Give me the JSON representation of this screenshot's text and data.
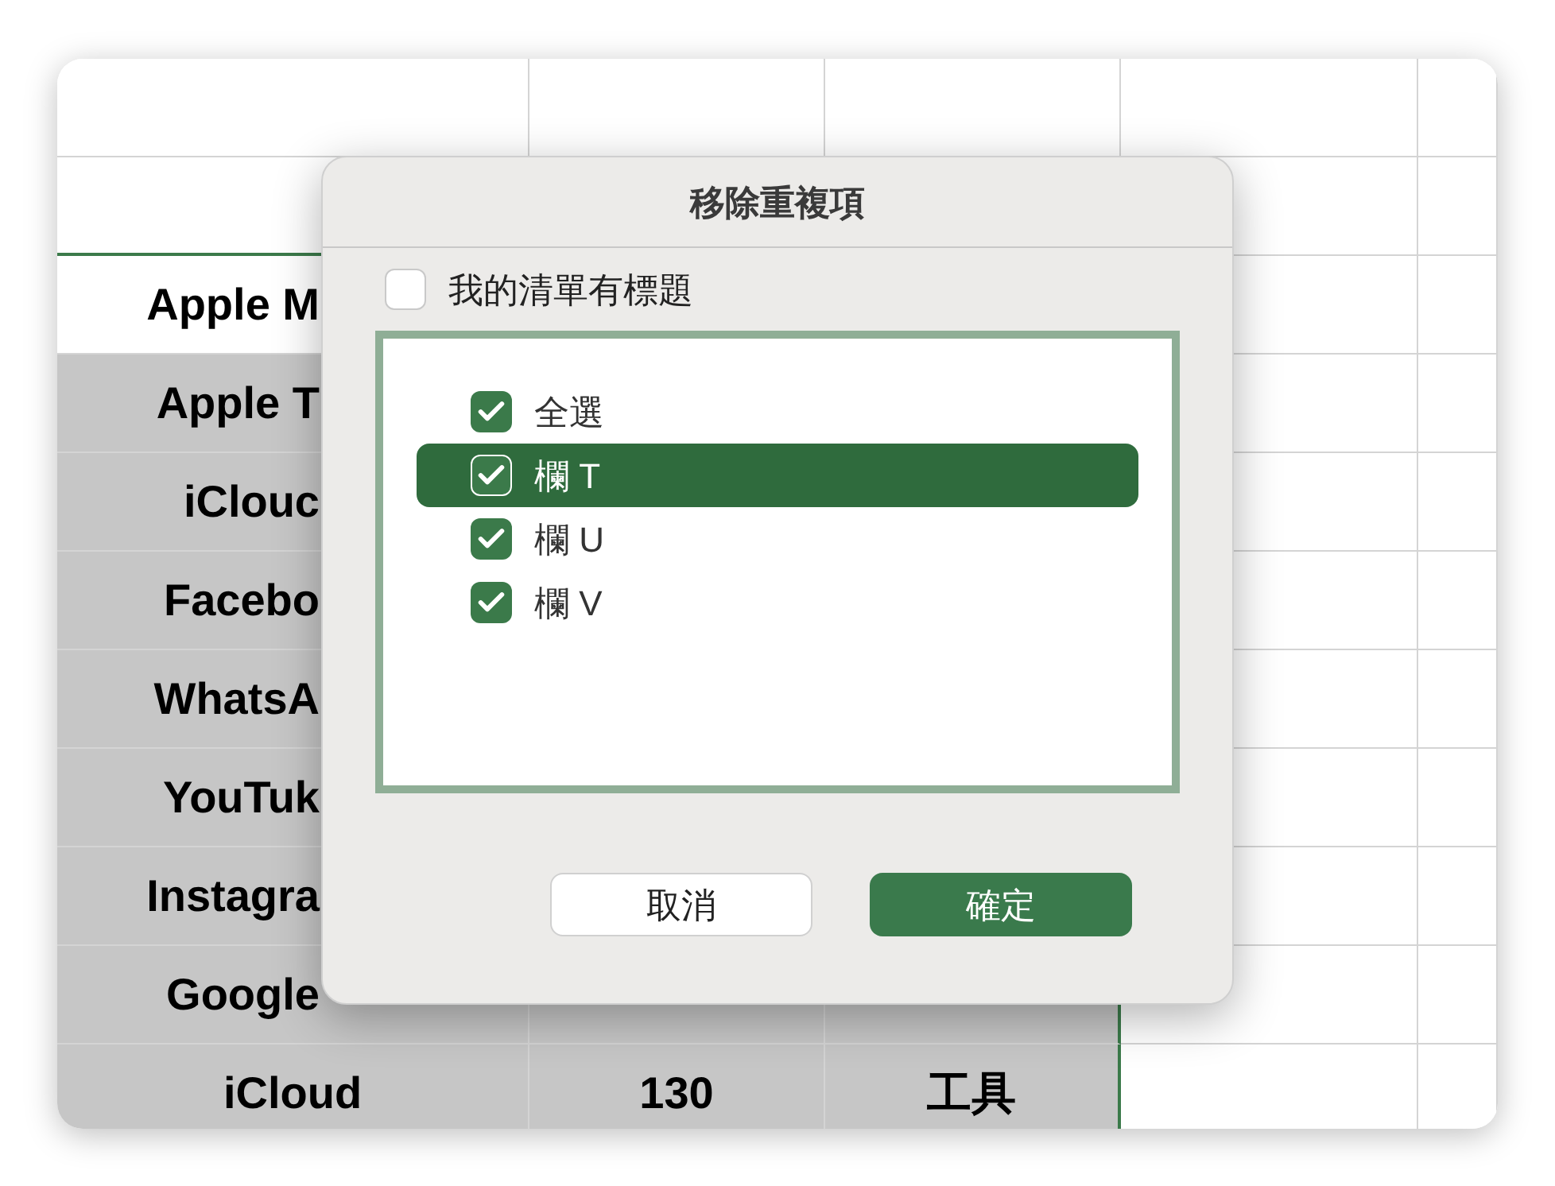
{
  "sheet": {
    "rows": [
      {
        "highlighted": false,
        "cells": [
          {
            "text": "Apple M",
            "cut": true
          }
        ]
      },
      {
        "highlighted": true,
        "cells": [
          {
            "text": "Apple T",
            "cut": true
          }
        ]
      },
      {
        "highlighted": true,
        "cells": [
          {
            "text": "iClouc",
            "cut": true
          }
        ]
      },
      {
        "highlighted": true,
        "cells": [
          {
            "text": "Facebo",
            "cut": true
          }
        ]
      },
      {
        "highlighted": true,
        "cells": [
          {
            "text": "WhatsA",
            "cut": true
          }
        ]
      },
      {
        "highlighted": true,
        "cells": [
          {
            "text": "YouTuk",
            "cut": true
          }
        ]
      },
      {
        "highlighted": true,
        "cells": [
          {
            "text": "Instagra",
            "cut": true
          }
        ]
      },
      {
        "highlighted": true,
        "cells": [
          {
            "text": "Google",
            "cut": true
          }
        ]
      },
      {
        "highlighted": true,
        "cells": [
          {
            "text": "iCloud",
            "cut": false
          },
          {
            "text": "130",
            "cut": false
          },
          {
            "text": "工具",
            "cut": false
          }
        ]
      }
    ]
  },
  "dialog": {
    "title": "移除重複項",
    "has_headers": {
      "label": "我的清單有標題",
      "checked": false
    },
    "columns": [
      {
        "label": "全選",
        "checked": true,
        "selected": false
      },
      {
        "label": "欄 T",
        "checked": true,
        "selected": true
      },
      {
        "label": "欄 U",
        "checked": true,
        "selected": false
      },
      {
        "label": "欄 V",
        "checked": true,
        "selected": false
      }
    ],
    "buttons": [
      {
        "label": "取消",
        "kind": "secondary"
      },
      {
        "label": "確定",
        "kind": "primary"
      }
    ]
  }
}
